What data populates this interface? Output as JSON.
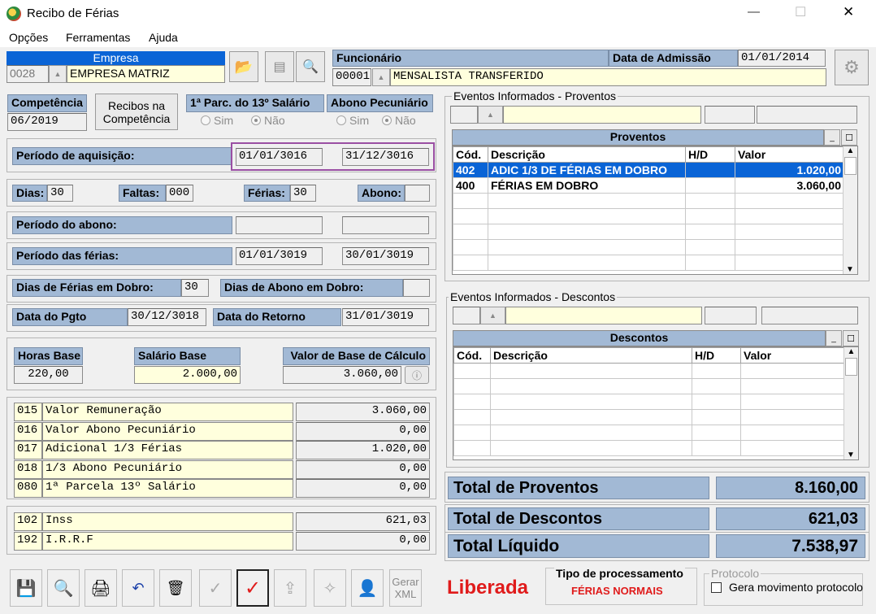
{
  "window": {
    "title": "Recibo de Férias",
    "minimize": "—",
    "maximize": "☐",
    "close": "✕"
  },
  "menu": [
    "Opções",
    "Ferramentas",
    "Ajuda"
  ],
  "empresa": {
    "label": "Empresa",
    "code": "0028",
    "name": "EMPRESA MATRIZ"
  },
  "funcionario": {
    "label": "Funcionário",
    "code": "00001",
    "name": "MENSALISTA TRANSFERIDO",
    "admissao_label": "Data de Admissão",
    "admissao": "01/01/2014"
  },
  "competencia": {
    "label": "Competência",
    "value": "06/2019",
    "recibos_button": "Recibos na Competência"
  },
  "parcela13": {
    "label": "1ª Parc. do 13º Salário",
    "sim": "Sim",
    "nao": "Não"
  },
  "abono": {
    "label": "Abono Pecuniário",
    "sim": "Sim",
    "nao": "Não"
  },
  "periodo_aquisicao": {
    "label": "Período de aquisição:",
    "inicio": "01/01/3016",
    "fim": "31/12/3016"
  },
  "contagem": {
    "dias_label": "Dias:",
    "dias": "30",
    "faltas_label": "Faltas:",
    "faltas": "000",
    "ferias_label": "Férias:",
    "ferias": "30",
    "abono_label": "Abono:",
    "abono": ""
  },
  "periodo_abono": {
    "label": "Período do abono:",
    "inicio": "",
    "fim": ""
  },
  "periodo_ferias": {
    "label": "Período das férias:",
    "inicio": "01/01/3019",
    "fim": "30/01/3019"
  },
  "dobro": {
    "ferias_label": "Dias de Férias em Dobro:",
    "ferias": "30",
    "abono_label": "Dias de Abono em Dobro:",
    "abono": ""
  },
  "datas": {
    "pgto_label": "Data do Pgto",
    "pgto": "30/12/3018",
    "retorno_label": "Data do Retorno",
    "retorno": "31/01/3019"
  },
  "base": {
    "horas_label": "Horas Base",
    "horas": "220,00",
    "salario_label": "Salário Base",
    "salario": "2.000,00",
    "calculo_label": "Valor de Base de Cálculo",
    "calculo": "3.060,00"
  },
  "calculo_rows": [
    {
      "code": "015",
      "desc": "Valor Remuneração",
      "value": "3.060,00"
    },
    {
      "code": "016",
      "desc": "Valor Abono Pecuniário",
      "value": "0,00"
    },
    {
      "code": "017",
      "desc": "Adicional 1/3 Férias",
      "value": "1.020,00"
    },
    {
      "code": "018",
      "desc": "1/3 Abono Pecuniário",
      "value": "0,00"
    },
    {
      "code": "080",
      "desc": "1ª Parcela 13º Salário",
      "value": "0,00"
    }
  ],
  "descontos_calc_rows": [
    {
      "code": "102",
      "desc": "Inss",
      "value": "621,03"
    },
    {
      "code": "192",
      "desc": "I.R.R.F",
      "value": "0,00"
    }
  ],
  "proventos": {
    "group_label": "Eventos Informados - Proventos",
    "title": "Proventos",
    "headers": [
      "Cód.",
      "Descrição",
      "H/D",
      "Valor"
    ],
    "rows": [
      {
        "cod": "402",
        "desc": "ADIC 1/3 DE FÉRIAS EM DOBRO",
        "hd": "",
        "valor": "1.020,00"
      },
      {
        "cod": "400",
        "desc": "FÉRIAS EM DOBRO",
        "hd": "",
        "valor": "3.060,00"
      }
    ]
  },
  "descontos": {
    "group_label": "Eventos Informados - Descontos",
    "title": "Descontos",
    "headers": [
      "Cód.",
      "Descrição",
      "H/D",
      "Valor"
    ],
    "rows": []
  },
  "totais": {
    "proventos_label": "Total de Proventos",
    "proventos": "8.160,00",
    "descontos_label": "Total de Descontos",
    "descontos": "621,03",
    "liquido_label": "Total Líquido",
    "liquido": "7.538,97"
  },
  "status": {
    "text": "Liberada",
    "color": "#e01b1b"
  },
  "tipo_processamento": {
    "label": "Tipo de processamento",
    "value": "FÉRIAS NORMAIS"
  },
  "protocolo": {
    "label": "Protocolo",
    "checkbox": "Gera movimento protocolo"
  },
  "toolbar": {
    "gerar_xml": "Gerar XML"
  },
  "colors": {
    "label_blue": "#a2b9d5",
    "selected_row": "#0a64d6",
    "field_yellow": "#ffffdd",
    "status_red": "#e01b1b"
  }
}
